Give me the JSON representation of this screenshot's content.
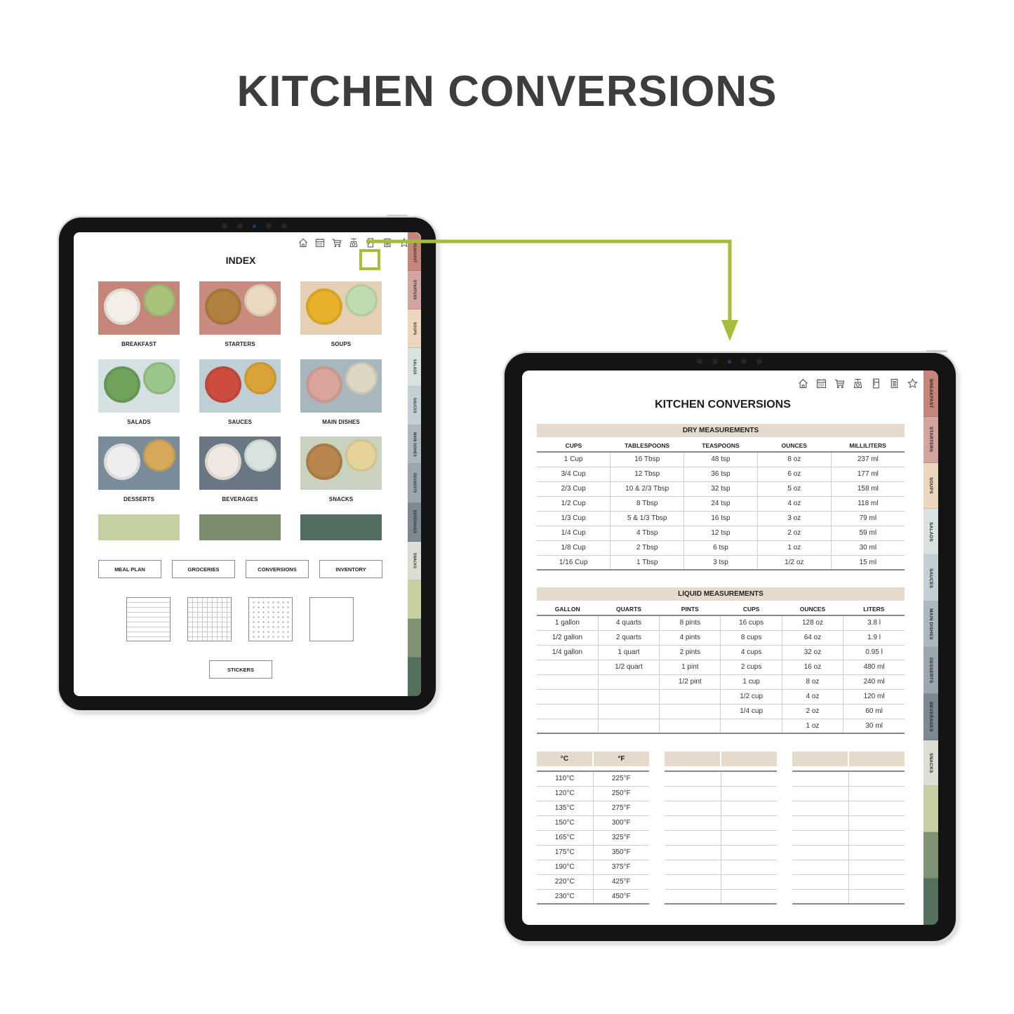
{
  "headline": "KITCHEN CONVERSIONS",
  "colors": {
    "accent_highlight": "#a5bd3a",
    "section_header_bg": "#e6dacd",
    "headline_text": "#3d3d3f"
  },
  "toolbar_icons": [
    "home-icon",
    "calendar-icon",
    "cart-icon",
    "scale-icon",
    "fridge-icon",
    "notepad-icon",
    "star-icon"
  ],
  "highlighted_icon": "scale-icon",
  "side_tabs": [
    {
      "label": "BREAKFAST",
      "color": "#c7857a"
    },
    {
      "label": "STARTERS",
      "color": "#d4a4a0"
    },
    {
      "label": "SOUPS",
      "color": "#ecd7bd"
    },
    {
      "label": "SALADS",
      "color": "#d9e2e3"
    },
    {
      "label": "SAUCES",
      "color": "#c3cfd3"
    },
    {
      "label": "MAIN DISHES",
      "color": "#acb8bd"
    },
    {
      "label": "DESSERTS",
      "color": "#9aa7b1"
    },
    {
      "label": "BEVERAGES",
      "color": "#7d8893"
    },
    {
      "label": "SNACKS",
      "color": "#dbdfd3"
    },
    {
      "label": "",
      "color": "#c5d0a1"
    },
    {
      "label": "",
      "color": "#7f9273"
    },
    {
      "label": "",
      "color": "#55705f"
    }
  ],
  "index_page": {
    "title": "INDEX",
    "categories": [
      {
        "label": "BREAKFAST",
        "bg": "#c4857a",
        "a": "#f3efe6",
        "b": "#a9c27a"
      },
      {
        "label": "STARTERS",
        "bg": "#c98a80",
        "a": "#b0803f",
        "b": "#e8d9c0"
      },
      {
        "label": "SOUPS",
        "bg": "#e5cfb5",
        "a": "#e7b22a",
        "b": "#bfdcb0"
      },
      {
        "label": "SALADS",
        "bg": "#d5e0e2",
        "a": "#6fa25b",
        "b": "#9cc58a"
      },
      {
        "label": "SAUCES",
        "bg": "#bfcfd6",
        "a": "#cc4d3f",
        "b": "#d9a33a"
      },
      {
        "label": "MAIN DISHES",
        "bg": "#a8b6bd",
        "a": "#d9a49a",
        "b": "#dcd6c3"
      },
      {
        "label": "DESSERTS",
        "bg": "#7a8b99",
        "a": "#eeeeee",
        "b": "#d6a95a"
      },
      {
        "label": "BEVERAGES",
        "bg": "#6a7885",
        "a": "#efe9e2",
        "b": "#d8e3e0"
      },
      {
        "label": "SNACKS",
        "bg": "#c9d1bf",
        "a": "#b7864c",
        "b": "#e4d49a"
      }
    ],
    "swatches": [
      "#c5d0a1",
      "#7a8e6e",
      "#536d60"
    ],
    "nav_buttons": [
      "MEAL PLAN",
      "GROCERIES",
      "CONVERSIONS",
      "INVENTORY"
    ],
    "paper_templates": [
      "lined-paper",
      "grid-paper",
      "dotted-paper",
      "blank-paper"
    ],
    "stickers_button": "STICKERS"
  },
  "conversions_page": {
    "title": "KITCHEN CONVERSIONS",
    "dry": {
      "title": "DRY MEASUREMENTS",
      "headers": [
        "CUPS",
        "TABLESPOONS",
        "TEASPOONS",
        "OUNCES",
        "MILLILITERS"
      ],
      "rows": [
        [
          "1 Cup",
          "16 Tbsp",
          "48 tsp",
          "8 oz",
          "237 ml"
        ],
        [
          "3/4 Cup",
          "12 Tbsp",
          "36 tsp",
          "6 oz",
          "177 ml"
        ],
        [
          "2/3 Cup",
          "10 & 2/3 Tbsp",
          "32 tsp",
          "5 oz",
          "158 ml"
        ],
        [
          "1/2 Cup",
          "8 Tbsp",
          "24 tsp",
          "4 oz",
          "118 ml"
        ],
        [
          "1/3 Cup",
          "5 & 1/3 Tbsp",
          "16 tsp",
          "3 oz",
          "79 ml"
        ],
        [
          "1/4 Cup",
          "4 Tbsp",
          "12 tsp",
          "2 oz",
          "59 ml"
        ],
        [
          "1/8 Cup",
          "2 Tbsp",
          "6 tsp",
          "1 oz",
          "30 ml"
        ],
        [
          "1/16 Cup",
          "1 Tbsp",
          "3 tsp",
          "1/2 oz",
          "15 ml"
        ]
      ]
    },
    "liquid": {
      "title": "LIQUID MEASUREMENTS",
      "headers": [
        "GALLON",
        "QUARTS",
        "PINTS",
        "CUPS",
        "OUNCES",
        "LITERS"
      ],
      "rows": [
        [
          "1 gallon",
          "4 quarts",
          "8 pints",
          "16 cups",
          "128 oz",
          "3.8 l"
        ],
        [
          "1/2 gallon",
          "2 quarts",
          "4 pints",
          "8 cups",
          "64 oz",
          "1.9 l"
        ],
        [
          "1/4 gallon",
          "1 quart",
          "2 pints",
          "4 cups",
          "32 oz",
          "0.95 l"
        ],
        [
          "",
          "1/2 quart",
          "1 pint",
          "2 cups",
          "16 oz",
          "480 ml"
        ],
        [
          "",
          "",
          "1/2 pint",
          "1 cup",
          "8 oz",
          "240 ml"
        ],
        [
          "",
          "",
          "",
          "1/2 cup",
          "4 oz",
          "120 ml"
        ],
        [
          "",
          "",
          "",
          "1/4 cup",
          "2 oz",
          "60 ml"
        ],
        [
          "",
          "",
          "",
          "",
          "1 oz",
          "30 ml"
        ]
      ]
    },
    "temperature": {
      "headers": [
        "°C",
        "°F"
      ],
      "rows": [
        [
          "110°C",
          "225°F"
        ],
        [
          "120°C",
          "250°F"
        ],
        [
          "135°C",
          "275°F"
        ],
        [
          "150°C",
          "300°F"
        ],
        [
          "165°C",
          "325°F"
        ],
        [
          "175°C",
          "350°F"
        ],
        [
          "190°C",
          "375°F"
        ],
        [
          "220°C",
          "425°F"
        ],
        [
          "230°C",
          "450°F"
        ]
      ]
    },
    "blank_tables": [
      {
        "headers": [
          "",
          ""
        ],
        "row_count": 9
      },
      {
        "headers": [
          "",
          ""
        ],
        "row_count": 9
      }
    ]
  }
}
